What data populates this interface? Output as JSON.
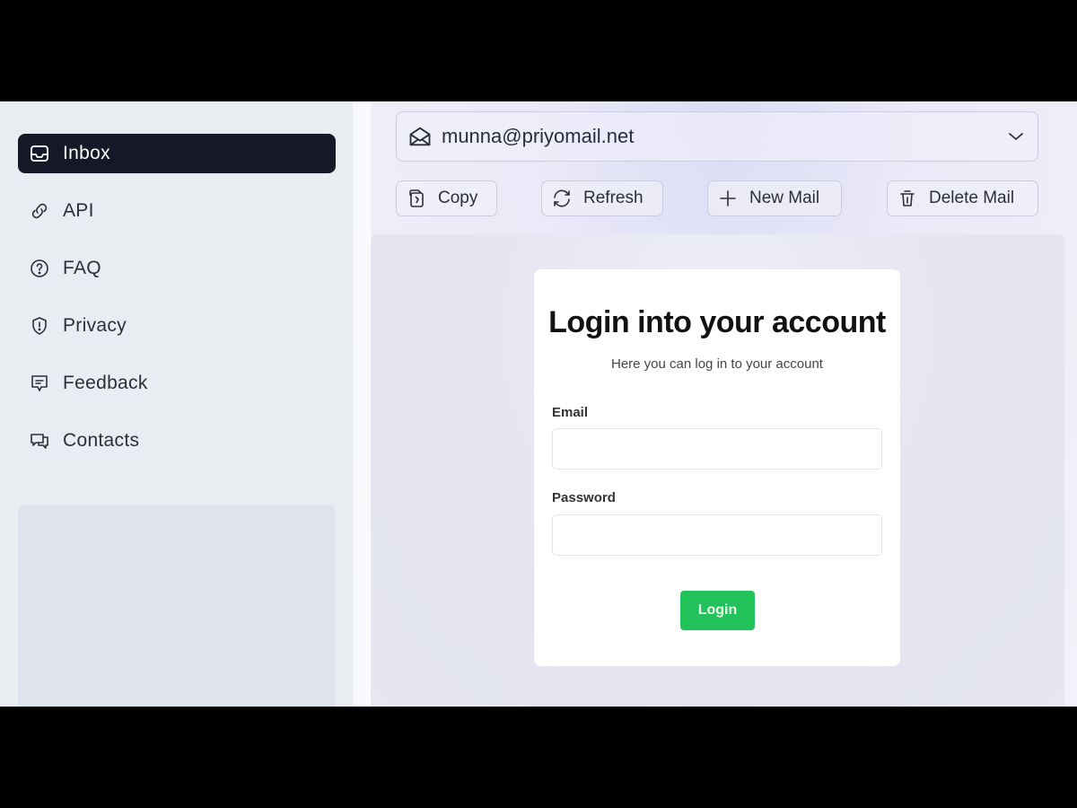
{
  "sidebar": {
    "items": [
      {
        "label": "Inbox",
        "icon": "inbox-icon",
        "active": true
      },
      {
        "label": "API",
        "icon": "link-icon",
        "active": false
      },
      {
        "label": "FAQ",
        "icon": "question-circle-icon",
        "active": false
      },
      {
        "label": "Privacy",
        "icon": "shield-icon",
        "active": false
      },
      {
        "label": "Feedback",
        "icon": "feedback-icon",
        "active": false
      },
      {
        "label": "Contacts",
        "icon": "chat-bubbles-icon",
        "active": false
      }
    ]
  },
  "header": {
    "email_address": "munna@priyomail.net"
  },
  "toolbar": {
    "copy_label": "Copy",
    "refresh_label": "Refresh",
    "new_mail_label": "New Mail",
    "delete_mail_label": "Delete Mail"
  },
  "login_card": {
    "title": "Login into your account",
    "subtitle": "Here you can log in to your account",
    "email_label": "Email",
    "email_value": "",
    "password_label": "Password",
    "password_value": "",
    "submit_label": "Login"
  },
  "colors": {
    "active_nav_bg": "#141827",
    "login_button": "#22c25a"
  }
}
